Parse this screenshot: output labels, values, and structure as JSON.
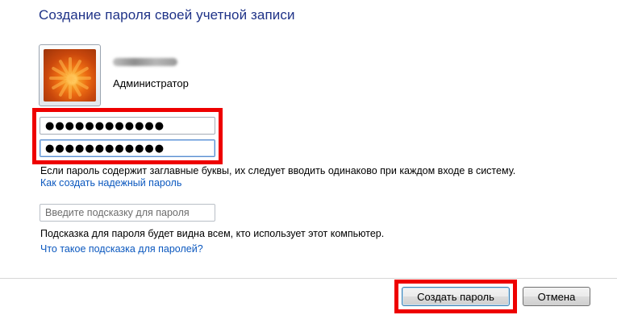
{
  "window": {
    "title": "Создание пароля своей учетной записи"
  },
  "account": {
    "type": "Администратор",
    "avatar_icon": "flower-avatar-icon"
  },
  "password": {
    "new_value": "●●●●●●●●●●●●",
    "confirm_value": "●●●●●●●●●●●●"
  },
  "info": {
    "case_note": "Если пароль содержит заглавные буквы, их следует вводить одинаково при каждом входе в систему.",
    "strong_password_link": "Как создать надежный пароль"
  },
  "hint": {
    "placeholder": "Введите подсказку для пароля",
    "note": "Подсказка для пароля будет видна всем, кто использует этот компьютер.",
    "link": "Что такое подсказка для паролей?"
  },
  "buttons": {
    "create": "Создать пароль",
    "cancel": "Отмена"
  },
  "colors": {
    "title": "#1e3287",
    "link": "#0b58bf",
    "highlight": "#ee0000"
  }
}
